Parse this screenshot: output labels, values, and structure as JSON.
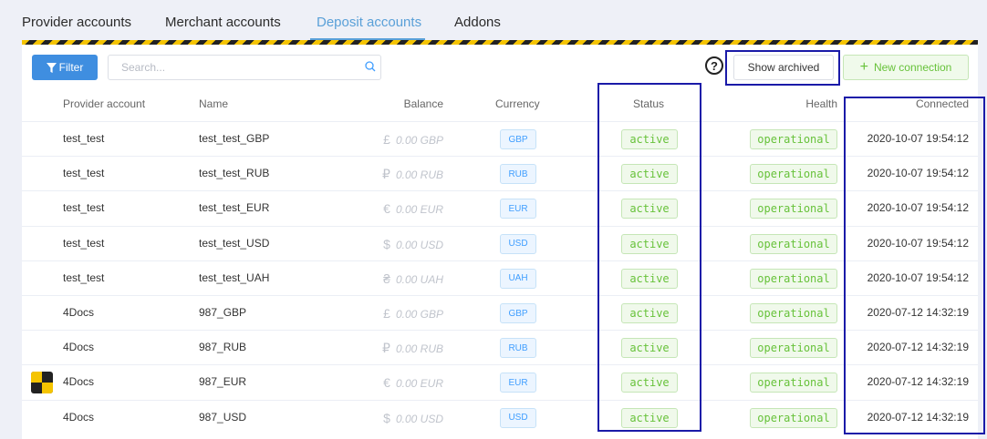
{
  "tabs": [
    {
      "label": "Provider accounts"
    },
    {
      "label": "Merchant accounts"
    },
    {
      "label": "Deposit accounts"
    },
    {
      "label": "Addons"
    }
  ],
  "toolbar": {
    "filter_label": "Filter",
    "search_placeholder": "Search...",
    "help_label": "?",
    "show_archived_label": "Show archived",
    "new_connection_label": "New connection"
  },
  "columns": {
    "provider_account": "Provider account",
    "name": "Name",
    "balance": "Balance",
    "currency": "Currency",
    "status": "Status",
    "health": "Health",
    "connected": "Connected"
  },
  "rows": [
    {
      "provider": "test_test",
      "name": "test_test_GBP",
      "symbol": "£",
      "balance": "0.00 GBP",
      "currency": "GBP",
      "status": "active",
      "health": "operational",
      "connected": "2020-10-07 19:54:12"
    },
    {
      "provider": "test_test",
      "name": "test_test_RUB",
      "symbol": "₽",
      "balance": "0.00 RUB",
      "currency": "RUB",
      "status": "active",
      "health": "operational",
      "connected": "2020-10-07 19:54:12"
    },
    {
      "provider": "test_test",
      "name": "test_test_EUR",
      "symbol": "€",
      "balance": "0.00 EUR",
      "currency": "EUR",
      "status": "active",
      "health": "operational",
      "connected": "2020-10-07 19:54:12"
    },
    {
      "provider": "test_test",
      "name": "test_test_USD",
      "symbol": "$",
      "balance": "0.00 USD",
      "currency": "USD",
      "status": "active",
      "health": "operational",
      "connected": "2020-10-07 19:54:12"
    },
    {
      "provider": "test_test",
      "name": "test_test_UAH",
      "symbol": "₴",
      "balance": "0.00 UAH",
      "currency": "UAH",
      "status": "active",
      "health": "operational",
      "connected": "2020-10-07 19:54:12"
    },
    {
      "provider": "4Docs",
      "name": "987_GBP",
      "symbol": "£",
      "balance": "0.00 GBP",
      "currency": "GBP",
      "status": "active",
      "health": "operational",
      "connected": "2020-07-12 14:32:19"
    },
    {
      "provider": "4Docs",
      "name": "987_RUB",
      "symbol": "₽",
      "balance": "0.00 RUB",
      "currency": "RUB",
      "status": "active",
      "health": "operational",
      "connected": "2020-07-12 14:32:19"
    },
    {
      "provider": "4Docs",
      "name": "987_EUR",
      "symbol": "€",
      "balance": "0.00 EUR",
      "currency": "EUR",
      "status": "active",
      "health": "operational",
      "connected": "2020-07-12 14:32:19"
    },
    {
      "provider": "4Docs",
      "name": "987_USD",
      "symbol": "$",
      "balance": "0.00 USD",
      "currency": "USD",
      "status": "active",
      "health": "operational",
      "connected": "2020-07-12 14:32:19"
    }
  ],
  "colors": {
    "accent": "#409eff",
    "active_tab": "#5aa0d8",
    "success": "#67c23a",
    "highlight_box": "#1a1aa8"
  },
  "icons": {
    "filter": "funnel-icon",
    "search": "magnifier-icon",
    "help": "question-circle-icon",
    "add": "plus-icon",
    "side_logo": "yellow-black-checker-logo"
  }
}
